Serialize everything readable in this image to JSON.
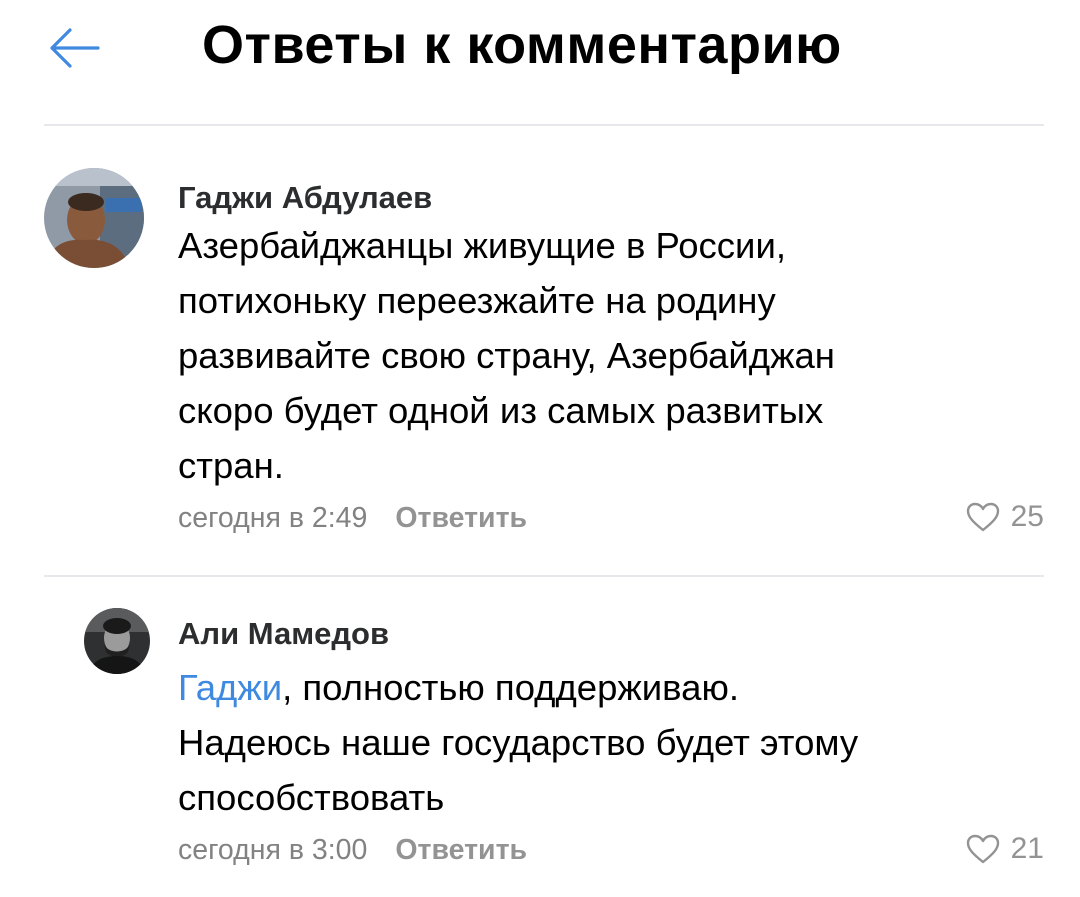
{
  "header": {
    "title": "Ответы к комментарию",
    "back_icon": "arrow-left-icon",
    "accent": "#3f8ae0"
  },
  "comments": [
    {
      "author": "Гаджи Абдулаев",
      "lines": [
        "Азербайджанцы живущие в России,",
        "потихоньку переезжайте на родину",
        "развивайте свою страну, Азербайджан",
        "скоро будет одной из самых развитых",
        "стран."
      ],
      "time": "сегодня в 2:49",
      "reply_label": "Ответить",
      "likes": "25",
      "like_icon": "heart-outline-icon"
    },
    {
      "author": "Али Мамедов",
      "mention": "Гаджи",
      "lines": [
        ",  полностью поддерживаю.",
        "Надеюсь наше государство будет этому",
        "способствовать"
      ],
      "time": "сегодня в 3:00",
      "reply_label": "Ответить",
      "likes": "21",
      "like_icon": "heart-outline-icon"
    }
  ],
  "colors": {
    "mention": "#3f8ae0",
    "meta": "#828282",
    "divider": "#e7e8ec"
  }
}
